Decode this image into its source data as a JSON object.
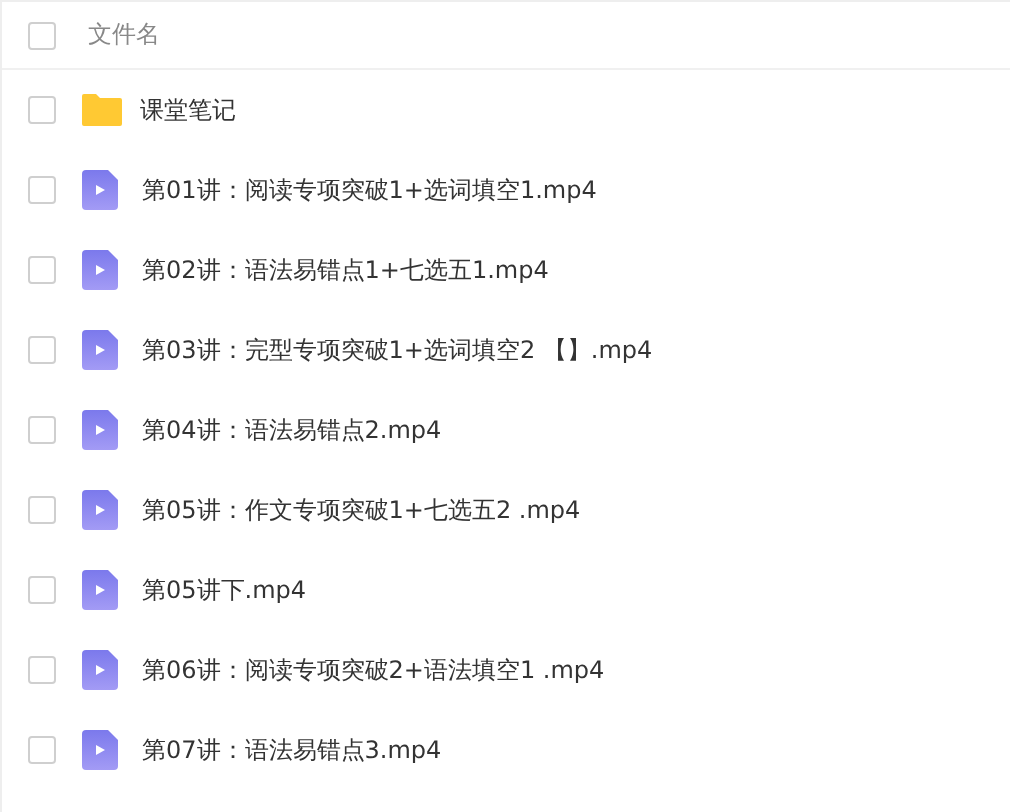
{
  "header": {
    "checked": false,
    "label": "文件名"
  },
  "files": [
    {
      "kind": "folder",
      "name": "课堂笔记",
      "checked": false
    },
    {
      "kind": "video",
      "name": "第01讲：阅读专项突破1+选词填空1.mp4",
      "checked": false
    },
    {
      "kind": "video",
      "name": "第02讲：语法易错点1+七选五1.mp4",
      "checked": false
    },
    {
      "kind": "video",
      "name": "第03讲：完型专项突破1+选词填空2 【】.mp4",
      "checked": false
    },
    {
      "kind": "video",
      "name": "第04讲：语法易错点2.mp4",
      "checked": false
    },
    {
      "kind": "video",
      "name": "第05讲：作文专项突破1+七选五2 .mp4",
      "checked": false
    },
    {
      "kind": "video",
      "name": "第05讲下.mp4",
      "checked": false
    },
    {
      "kind": "video",
      "name": "第06讲：阅读专项突破2+语法填空1 .mp4",
      "checked": false
    },
    {
      "kind": "video",
      "name": "第07讲：语法易错点3.mp4",
      "checked": false
    }
  ]
}
